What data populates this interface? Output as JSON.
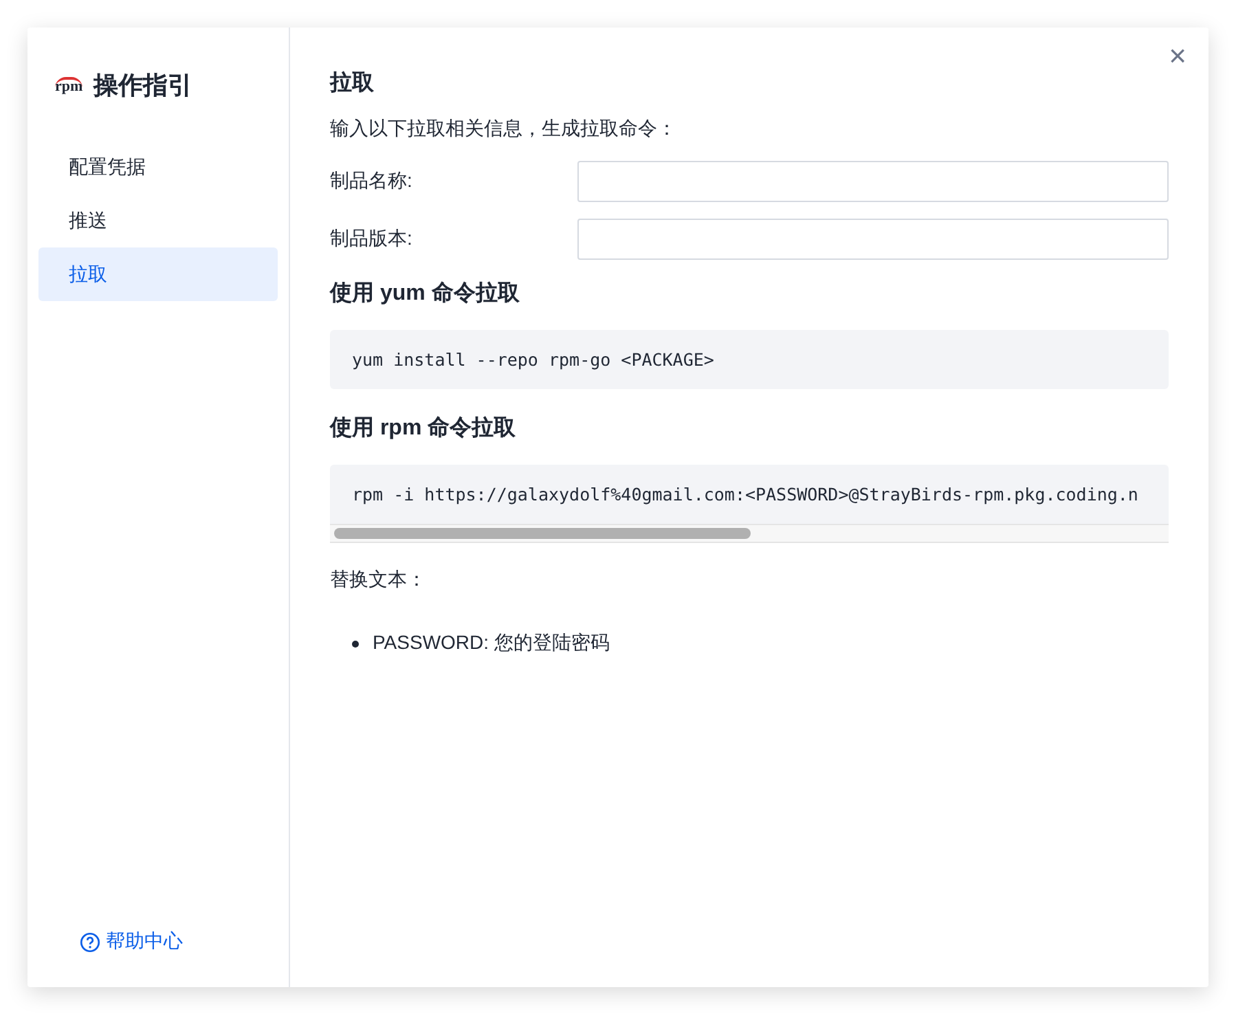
{
  "sidebar": {
    "logo_text": "rpm",
    "title": "操作指引",
    "items": [
      {
        "label": "配置凭据",
        "selected": false
      },
      {
        "label": "推送",
        "selected": false
      },
      {
        "label": "拉取",
        "selected": true
      }
    ],
    "help_link": "帮助中心"
  },
  "close_button": "×",
  "content": {
    "title": "拉取",
    "intro": "输入以下拉取相关信息，生成拉取命令：",
    "fields": [
      {
        "label": "制品名称:"
      },
      {
        "label": "制品版本:"
      }
    ],
    "sections": [
      {
        "heading": "使用 yum 命令拉取",
        "command": "yum install --repo rpm-go <PACKAGE>",
        "scrollable": false
      },
      {
        "heading": "使用 rpm 命令拉取",
        "command": "rpm -i https://galaxydolf%40gmail.com:<PASSWORD>@StrayBirds-rpm.pkg.coding.n",
        "scrollable": true
      }
    ],
    "replace_label": "替换文本：",
    "replacements": [
      "PASSWORD: 您的登陆密码"
    ]
  }
}
